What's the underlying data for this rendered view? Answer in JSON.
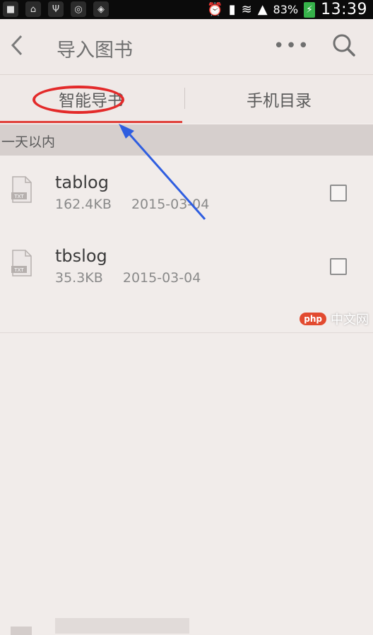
{
  "status_bar": {
    "icons": [
      "notification-icon",
      "home-icon",
      "usb-icon",
      "gps-icon",
      "shield-icon",
      "alarm-icon",
      "download-icon",
      "wifi-icon",
      "signal-icon"
    ],
    "battery": "83%",
    "time": "13:39"
  },
  "app_bar": {
    "back_icon": "back-chevron-icon",
    "title": "导入图书",
    "more_icon": "more-dots-icon",
    "search_icon": "search-icon"
  },
  "tabs": [
    {
      "label": "智能导书",
      "selected": true
    },
    {
      "label": "手机目录",
      "selected": false
    }
  ],
  "section": {
    "label": "一天以内"
  },
  "files": [
    {
      "name": "tablog",
      "size": "162.4KB",
      "date": "2015-03-04",
      "checked": false
    },
    {
      "name": "tbslog",
      "size": "35.3KB",
      "date": "2015-03-04",
      "checked": false
    }
  ],
  "file_icon_label": "TXT",
  "watermark": {
    "badge": "php",
    "text": "中文网"
  },
  "colors": {
    "accent": "#e0403a",
    "annotation_oval": "#e32a2a",
    "annotation_arrow": "#2f5ee0"
  }
}
